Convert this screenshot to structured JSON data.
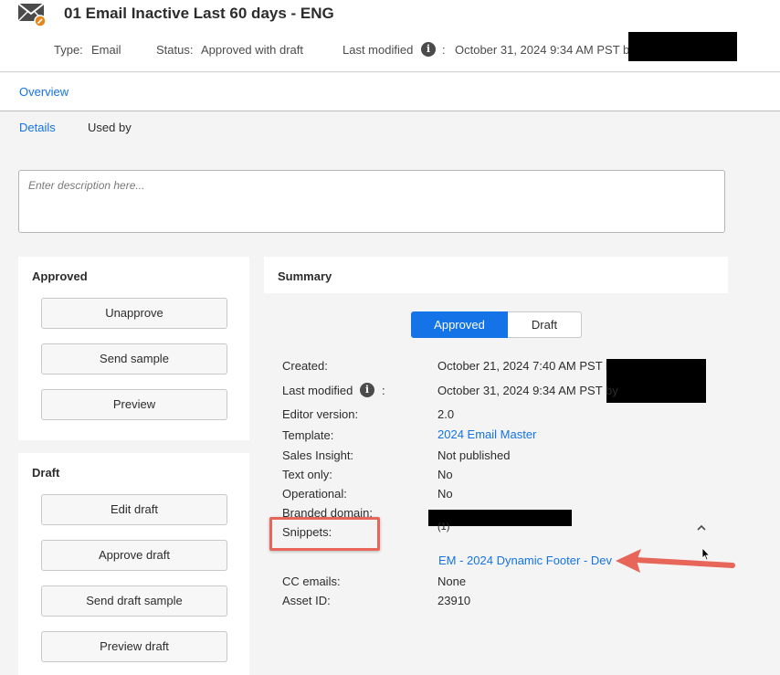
{
  "header": {
    "title": "01 Email Inactive Last 60 days - ENG",
    "type_label": "Type:",
    "type_value": "Email",
    "status_label": "Status:",
    "status_value": "Approved with draft",
    "modified_label": "Last modified",
    "info_glyph": "i",
    "modified_colon": ":",
    "modified_value": "October 31, 2024 9:34 AM PST by"
  },
  "overview": {
    "tab_label": "Overview"
  },
  "subtabs": {
    "details": "Details",
    "used_by": "Used by"
  },
  "description": {
    "placeholder": "Enter description here..."
  },
  "approved_panel": {
    "title": "Approved",
    "buttons": [
      "Unapprove",
      "Send sample",
      "Preview"
    ]
  },
  "draft_panel": {
    "title": "Draft",
    "buttons": [
      "Edit draft",
      "Approve draft",
      "Send draft sample",
      "Preview draft"
    ]
  },
  "summary": {
    "title": "Summary",
    "toggle": {
      "approved": "Approved",
      "draft": "Draft",
      "selected": "Approved"
    },
    "rows": {
      "created": {
        "label": "Created:",
        "value": "October 21, 2024 7:40 AM PST by"
      },
      "last_modified": {
        "label": "Last modified",
        "colon": ":",
        "value": "October 31, 2024 9:34 AM PST by"
      },
      "editor_version": {
        "label": "Editor version:",
        "value": "2.0"
      },
      "template": {
        "label": "Template:",
        "value": "2024 Email Master"
      },
      "sales_insight": {
        "label": "Sales Insight:",
        "value": "Not published"
      },
      "text_only": {
        "label": "Text only:",
        "value": "No"
      },
      "operational": {
        "label": "Operational:",
        "value": "No"
      },
      "branded_domain": {
        "label": "Branded domain:"
      },
      "snippets": {
        "label": "Snippets:",
        "count": "(1)",
        "item": "EM - 2024 Dynamic Footer - Dev"
      },
      "cc_emails": {
        "label": "CC emails:",
        "value": "None"
      },
      "asset_id": {
        "label": "Asset ID:",
        "value": "23910"
      }
    }
  },
  "colors": {
    "accent": "#1473e6",
    "annotation": "#e8655a",
    "redaction": "#000000"
  },
  "icons": [
    "email-icon",
    "edit-badge-icon",
    "info-icon",
    "chevron-up-icon",
    "arrow-annotation-icon",
    "mouse-cursor-icon"
  ]
}
